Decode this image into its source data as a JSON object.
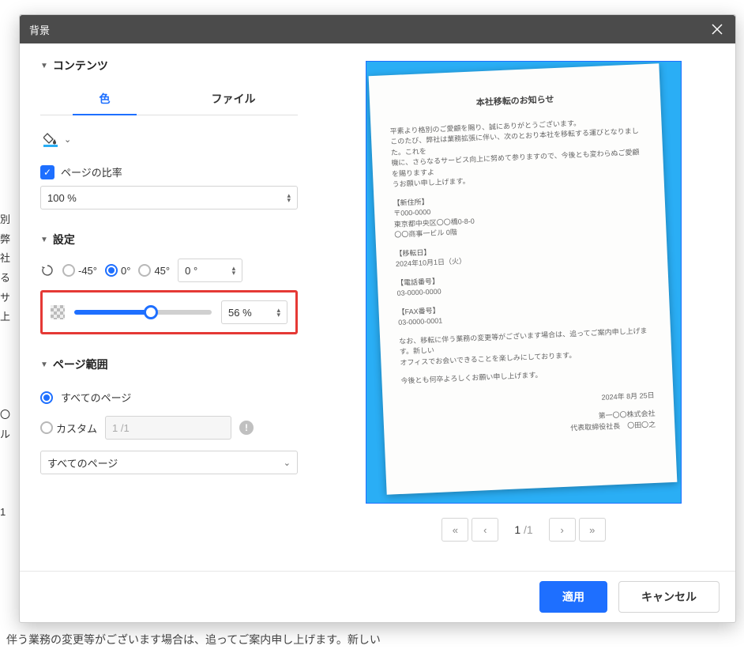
{
  "dialog": {
    "title": "背景",
    "apply": "適用",
    "cancel": "キャンセル"
  },
  "contents": {
    "header": "コンテンツ",
    "tab_color": "色",
    "tab_file": "ファイル",
    "ratio_label": "ページの比率",
    "ratio_value": "100 %"
  },
  "settings": {
    "header": "設定",
    "rot_neg45": "-45°",
    "rot_0": "0°",
    "rot_45": "45°",
    "rot_value": "0 °",
    "opacity_value": "56 %",
    "opacity_pct": 56
  },
  "range": {
    "header": "ページ範囲",
    "all_pages": "すべてのページ",
    "custom": "カスタム",
    "custom_placeholder": "1 /1",
    "select": "すべてのページ"
  },
  "pager": {
    "cur": "1",
    "sep": "/",
    "total": "1"
  },
  "document": {
    "title": "本社移転のお知らせ",
    "intro1": "平素より格別のご愛顧を賜り、誠にありがとうございます。",
    "intro2": "このたび、弊社は業務拡張に伴い、次のとおり本社を移転する運びとなりました。これを",
    "intro3": "機に、さらなるサービス向上に努めて参りますので、今後とも変わらぬご愛顧を賜りますよ",
    "intro4": "うお願い申し上げます。",
    "addr_h": "【新住所】",
    "addr_1": "〒000-0000",
    "addr_2": "東京都中央区〇〇橋0-8-0",
    "addr_3": "〇〇商事一ビル 0階",
    "movedate_h": "【移転日】",
    "movedate": "2024年10月1日（火）",
    "tel_h": "【電話番号】",
    "tel": "03-0000-0000",
    "fax_h": "【FAX番号】",
    "fax": "03-0000-0001",
    "note1": "なお、移転に伴う業務の変更等がございます場合は、追ってご案内申し上げます。新しい",
    "note2": "オフィスでお会いできることを楽しみにしております。",
    "closing": "今後とも何卒よろしくお願い申し上げます。",
    "date": "2024年 8月 25日",
    "company": "第一〇〇株式会社",
    "rep": "代表取締役社長　〇田〇之"
  },
  "backdrop": "伴う業務の変更等がございます場合は、追ってご案内申し上げます。新しい"
}
